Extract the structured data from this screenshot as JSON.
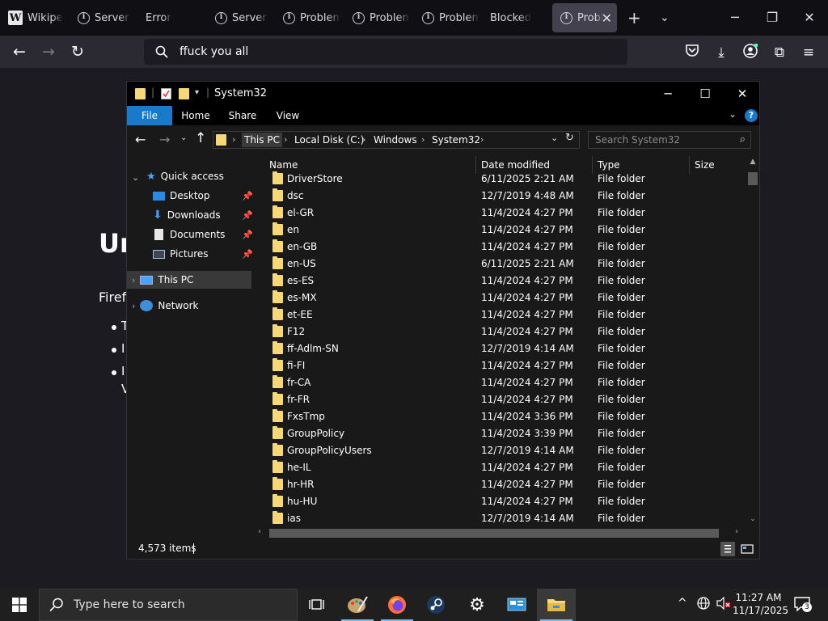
{
  "browser": {
    "tabs": [
      {
        "label": "Wikipedia",
        "icon": "wikipedia-icon"
      },
      {
        "label": "Server Not Found",
        "icon": "info-icon"
      },
      {
        "label": "Error",
        "icon": ""
      },
      {
        "label": "Server Not Found",
        "icon": "info-icon"
      },
      {
        "label": "Problem loading page",
        "icon": "info-icon"
      },
      {
        "label": "Problem loading page",
        "icon": "info-icon"
      },
      {
        "label": "Problem loading page",
        "icon": "info-icon"
      },
      {
        "label": "Blocked",
        "icon": ""
      },
      {
        "label": "Problem loading page",
        "icon": "info-icon",
        "active": true
      }
    ],
    "url_value": "ffuck you all",
    "page": {
      "heading": "Ur",
      "paragraph": "Firef",
      "bullets": [
        "T",
        "I",
        "I",
        "V"
      ]
    }
  },
  "explorer": {
    "title": "System32",
    "ribbon_tabs": [
      "File",
      "Home",
      "Share",
      "View"
    ],
    "breadcrumb": [
      "This PC",
      "Local Disk (C:)",
      "Windows",
      "System32"
    ],
    "search_placeholder": "Search System32",
    "nav": {
      "quick_access": "Quick access",
      "quick_items": [
        "Desktop",
        "Downloads",
        "Documents",
        "Pictures"
      ],
      "this_pc": "This PC",
      "network": "Network"
    },
    "columns": [
      "Name",
      "Date modified",
      "Type",
      "Size"
    ],
    "rows": [
      {
        "name": "DriverStore",
        "date": "6/11/2025 2:21 AM",
        "type": "File folder"
      },
      {
        "name": "dsc",
        "date": "12/7/2019 4:48 AM",
        "type": "File folder"
      },
      {
        "name": "el-GR",
        "date": "11/4/2024 4:27 PM",
        "type": "File folder"
      },
      {
        "name": "en",
        "date": "11/4/2024 4:27 PM",
        "type": "File folder"
      },
      {
        "name": "en-GB",
        "date": "11/4/2024 4:27 PM",
        "type": "File folder"
      },
      {
        "name": "en-US",
        "date": "6/11/2025 2:21 AM",
        "type": "File folder"
      },
      {
        "name": "es-ES",
        "date": "11/4/2024 4:27 PM",
        "type": "File folder"
      },
      {
        "name": "es-MX",
        "date": "11/4/2024 4:27 PM",
        "type": "File folder"
      },
      {
        "name": "et-EE",
        "date": "11/4/2024 4:27 PM",
        "type": "File folder"
      },
      {
        "name": "F12",
        "date": "11/4/2024 4:27 PM",
        "type": "File folder"
      },
      {
        "name": "ff-Adlm-SN",
        "date": "12/7/2019 4:14 AM",
        "type": "File folder"
      },
      {
        "name": "fi-FI",
        "date": "11/4/2024 4:27 PM",
        "type": "File folder"
      },
      {
        "name": "fr-CA",
        "date": "11/4/2024 4:27 PM",
        "type": "File folder"
      },
      {
        "name": "fr-FR",
        "date": "11/4/2024 4:27 PM",
        "type": "File folder"
      },
      {
        "name": "FxsTmp",
        "date": "11/4/2024 3:36 PM",
        "type": "File folder"
      },
      {
        "name": "GroupPolicy",
        "date": "11/4/2024 3:39 PM",
        "type": "File folder"
      },
      {
        "name": "GroupPolicyUsers",
        "date": "12/7/2019 4:14 AM",
        "type": "File folder"
      },
      {
        "name": "he-IL",
        "date": "11/4/2024 4:27 PM",
        "type": "File folder"
      },
      {
        "name": "hr-HR",
        "date": "11/4/2024 4:27 PM",
        "type": "File folder"
      },
      {
        "name": "hu-HU",
        "date": "11/4/2024 4:27 PM",
        "type": "File folder"
      },
      {
        "name": "ias",
        "date": "12/7/2019 4:14 AM",
        "type": "File folder"
      }
    ],
    "status": "4,573 items"
  },
  "taskbar": {
    "search_placeholder": "Type here to search",
    "time": "11:27 AM",
    "date": "11/17/2025",
    "notification_count": "3",
    "accent": "#76b9ed"
  },
  "colors": {
    "folder": "#f8d775",
    "file_tab": "#1979ca",
    "firefox_toolbar": "#2b2a33"
  }
}
